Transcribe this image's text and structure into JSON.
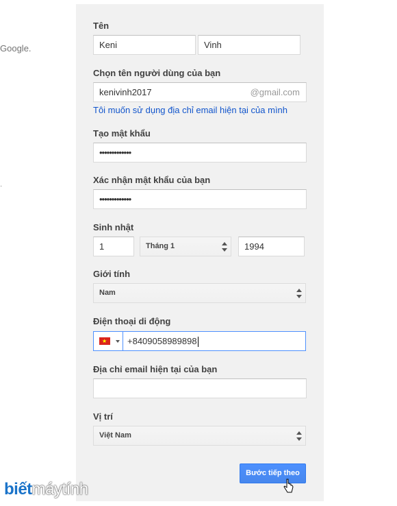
{
  "left_fragment": "Google.",
  "left_tick": "·",
  "form": {
    "name": {
      "label": "Tên",
      "first": "Keni",
      "last": "Vinh"
    },
    "username": {
      "label": "Chọn tên người dùng của bạn",
      "value": "kenivinh2017",
      "suffix": "@gmail.com",
      "alt_link": "Tôi muốn sử dụng địa chỉ email hiện tại của mình"
    },
    "password": {
      "label": "Tạo mật khẩu",
      "value": "•••••••••••••"
    },
    "confirm": {
      "label": "Xác nhận mật khẩu của bạn",
      "value": "•••••••••••••"
    },
    "birthday": {
      "label": "Sinh nhật",
      "day": "1",
      "month": "Tháng 1",
      "year": "1994"
    },
    "gender": {
      "label": "Giới tính",
      "value": "Nam"
    },
    "phone": {
      "label": "Điện thoại di động",
      "value": "+8409058989898",
      "flag": "vietnam-flag-icon"
    },
    "current_email": {
      "label": "Địa chỉ email hiện tại của bạn",
      "value": ""
    },
    "location": {
      "label": "Vị trí",
      "value": "Việt Nam"
    },
    "next_button": "Bước tiếp theo"
  },
  "watermark": {
    "part1": "biết",
    "part2": "máytính"
  },
  "colors": {
    "accent": "#4d90fe",
    "link": "#1155cc",
    "panel": "#f1f1f1"
  }
}
